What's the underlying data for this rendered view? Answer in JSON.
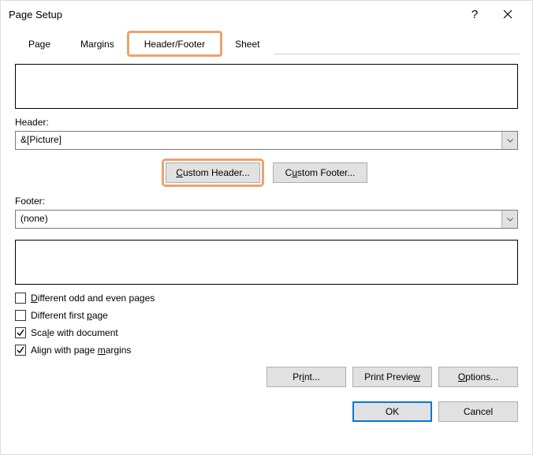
{
  "title": "Page Setup",
  "help_glyph": "?",
  "tabs": {
    "page": "Page",
    "margins": "Margins",
    "header_footer": "Header/Footer",
    "sheet": "Sheet"
  },
  "active_tab": "header_footer",
  "header_label": "Header:",
  "header_value": "&[Picture]",
  "footer_label": "Footer:",
  "footer_value": "(none)",
  "buttons": {
    "custom_header_pre": "C",
    "custom_header_post": "ustom Header...",
    "custom_footer_pre": "C",
    "custom_footer_mid": "u",
    "custom_footer_post": "stom Footer...",
    "print_pre": "Pr",
    "print_mid": "i",
    "print_post": "nt...",
    "print_preview_pre": "Print Previe",
    "print_preview_mid": "w",
    "print_preview_post": "",
    "options_pre": "",
    "options_mid": "O",
    "options_post": "ptions...",
    "ok": "OK",
    "cancel": "Cancel"
  },
  "checks": {
    "diff_odd_even_pre": "",
    "diff_odd_even_mid": "D",
    "diff_odd_even_post": "ifferent odd and even pages",
    "diff_odd_even_checked": "",
    "diff_first_pre": "Different first ",
    "diff_first_mid": "p",
    "diff_first_post": "age",
    "diff_first_checked": "",
    "scale_pre": "Sca",
    "scale_mid": "l",
    "scale_post": "e with document",
    "scale_checked": "checked",
    "align_pre": "Align with page ",
    "align_mid": "m",
    "align_post": "argins",
    "align_checked": "checked"
  }
}
